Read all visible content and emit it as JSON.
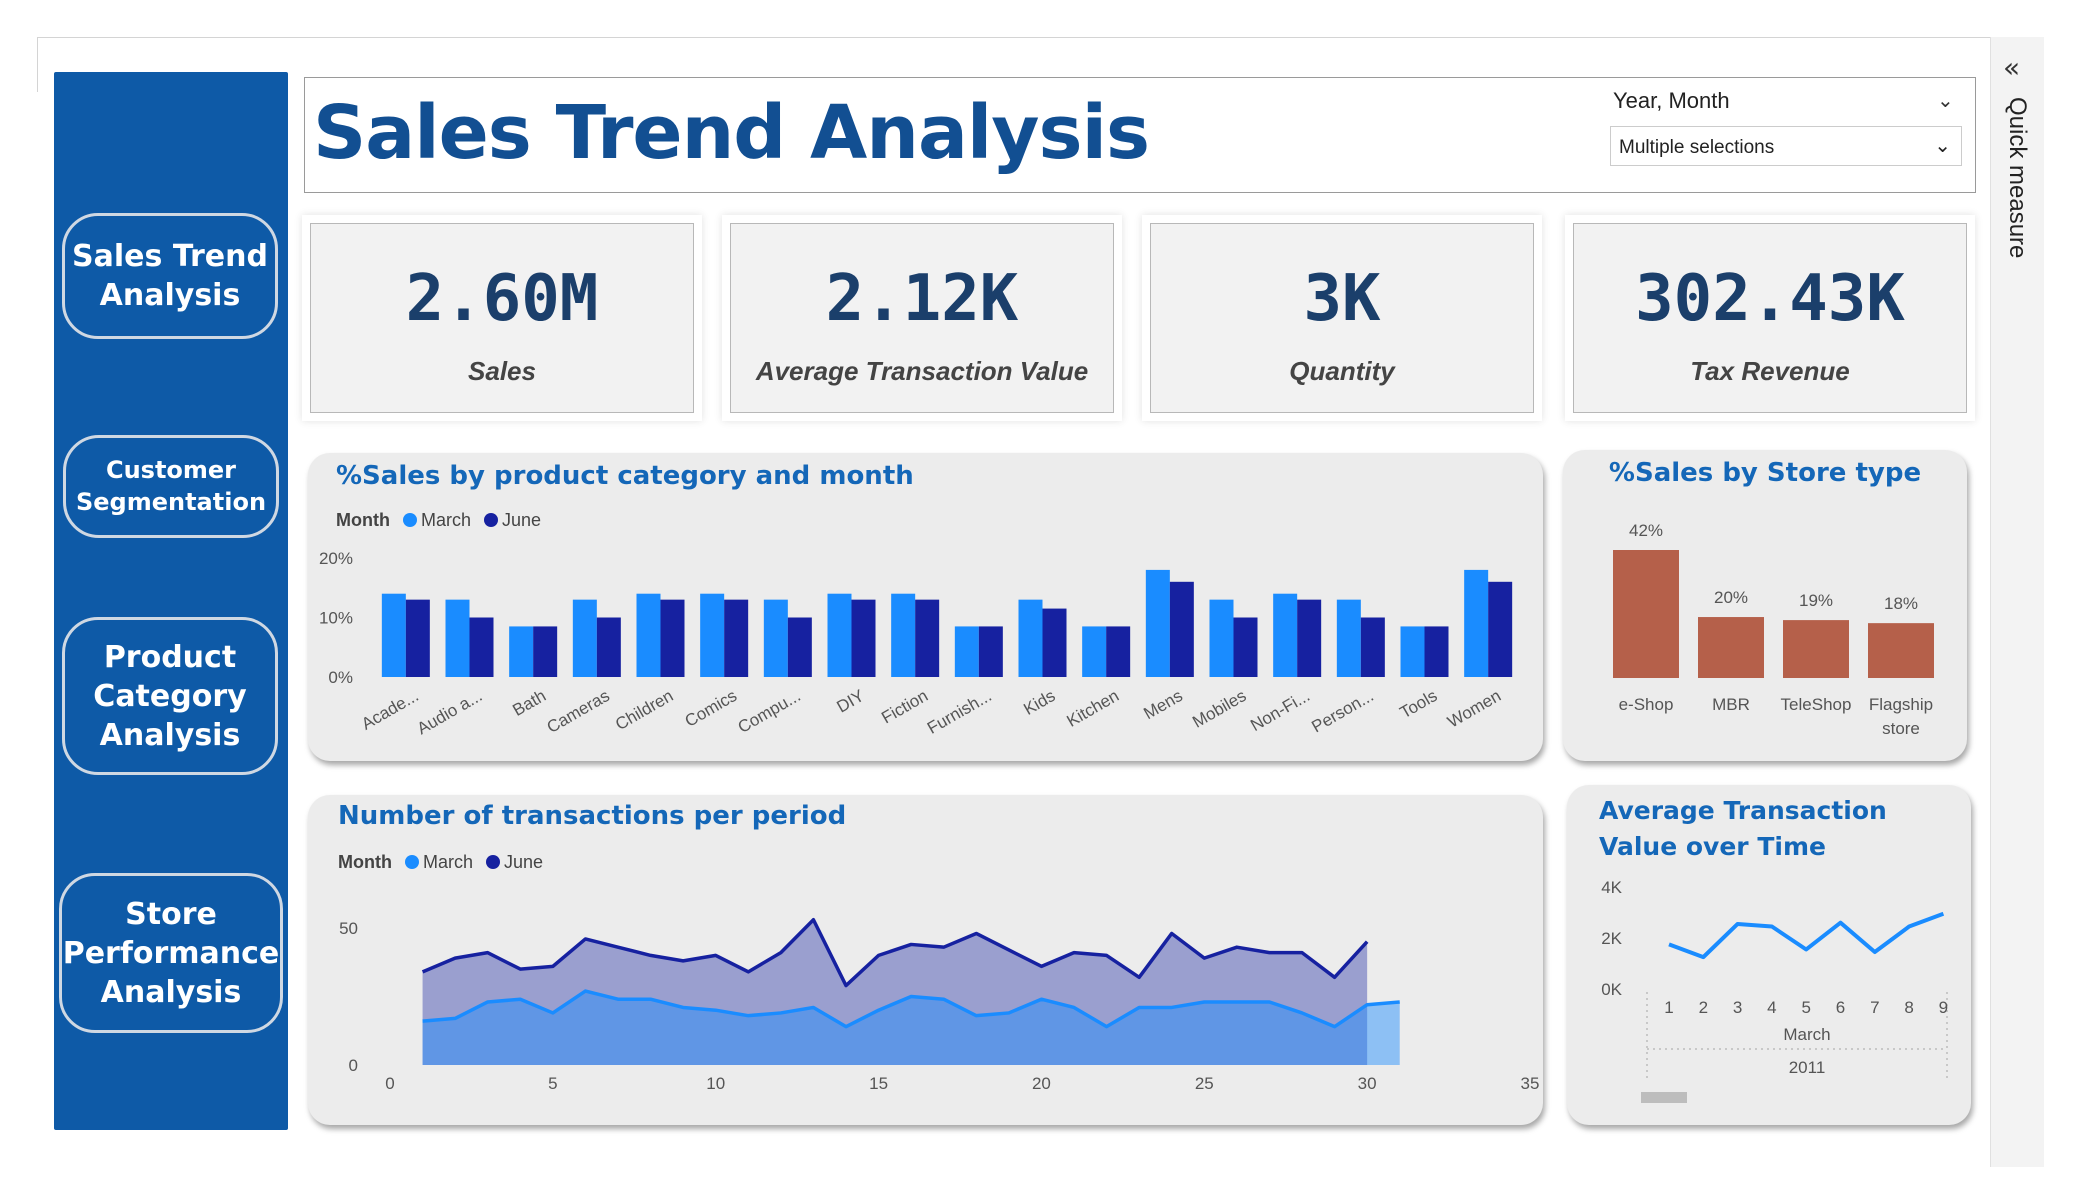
{
  "sidebar": {
    "items": [
      {
        "lines": [
          "Sales Trend",
          "Analysis"
        ]
      },
      {
        "lines": [
          "Customer",
          "Segmentation"
        ]
      },
      {
        "lines": [
          "Product",
          "Category",
          "Analysis"
        ]
      },
      {
        "lines": [
          "Store",
          "Performance",
          "Analysis"
        ]
      }
    ]
  },
  "header": {
    "title": "Sales Trend Analysis",
    "slicer": {
      "label": "Year, Month",
      "value": "Multiple selections"
    }
  },
  "quick_pane": {
    "label": "Quick measure"
  },
  "kpis": [
    {
      "value": "2.60M",
      "label": "Sales"
    },
    {
      "value": "2.12K",
      "label": "Average Transaction Value"
    },
    {
      "value": "3K",
      "label": "Quantity"
    },
    {
      "value": "302.43K",
      "label": "Tax Revenue"
    }
  ],
  "colors": {
    "march": "#1a8cff",
    "june": "#1621a0",
    "store": "#b5604a",
    "accent": "#1467b8",
    "sidebar": "#0e5aa7"
  },
  "chart_data": [
    {
      "type": "bar",
      "title": "%Sales by product category and month",
      "legend_title": "Month",
      "categories": [
        "Acade...",
        "Audio a...",
        "Bath",
        "Cameras",
        "Children",
        "Comics",
        "Compu...",
        "DIY",
        "Fiction",
        "Furnish...",
        "Kids",
        "Kitchen",
        "Mens",
        "Mobiles",
        "Non-Fi...",
        "Person...",
        "Tools",
        "Women"
      ],
      "series": [
        {
          "name": "March",
          "values": [
            14,
            13,
            8.5,
            13,
            14,
            14,
            13,
            14,
            14,
            8.5,
            13,
            8.5,
            18,
            13,
            14,
            13,
            8.5,
            18
          ]
        },
        {
          "name": "June",
          "values": [
            13,
            10,
            8.5,
            10,
            13,
            13,
            10,
            13,
            13,
            8.5,
            11.5,
            8.5,
            16,
            10,
            13,
            10,
            8.5,
            16
          ]
        }
      ],
      "yticks": [
        "0%",
        "10%",
        "20%"
      ],
      "ylim": [
        0,
        20
      ]
    },
    {
      "type": "bar",
      "title": "%Sales by Store type",
      "categories": [
        "e-Shop",
        "MBR",
        "TeleShop",
        "Flagship store"
      ],
      "values": [
        42,
        20,
        19,
        18
      ],
      "data_labels": [
        "42%",
        "20%",
        "19%",
        "18%"
      ]
    },
    {
      "type": "area",
      "title": "Number of transactions per period",
      "legend_title": "Month",
      "xticks": [
        "0",
        "5",
        "10",
        "15",
        "20",
        "25",
        "30",
        "35"
      ],
      "yticks": [
        "0",
        "50"
      ],
      "xlim": [
        0,
        35
      ],
      "ylim": [
        0,
        50
      ],
      "series": [
        {
          "name": "March",
          "x": [
            1,
            2,
            3,
            4,
            5,
            6,
            7,
            8,
            9,
            10,
            11,
            12,
            13,
            14,
            15,
            16,
            17,
            18,
            19,
            20,
            21,
            22,
            23,
            24,
            25,
            26,
            27,
            28,
            29,
            30,
            31
          ],
          "values": [
            16,
            17,
            23,
            24,
            19,
            27,
            24,
            24,
            21,
            20,
            18,
            19,
            21,
            14,
            20,
            25,
            24,
            18,
            19,
            24,
            21,
            14,
            21,
            21,
            23,
            23,
            23,
            19,
            14,
            22,
            23
          ]
        },
        {
          "name": "June",
          "x": [
            1,
            2,
            3,
            4,
            5,
            6,
            7,
            8,
            9,
            10,
            11,
            12,
            13,
            14,
            15,
            16,
            17,
            18,
            19,
            20,
            21,
            22,
            23,
            24,
            25,
            26,
            27,
            28,
            29,
            30
          ],
          "values": [
            34,
            39,
            41,
            35,
            36,
            46,
            43,
            40,
            38,
            40,
            34,
            41,
            53,
            29,
            40,
            44,
            43,
            48,
            42,
            36,
            41,
            40,
            32,
            48,
            39,
            43,
            41,
            41,
            32,
            45
          ]
        }
      ]
    },
    {
      "type": "line",
      "title": "Average Transaction Value over Time",
      "x": [
        "1",
        "2",
        "3",
        "4",
        "5",
        "6",
        "7",
        "8",
        "9"
      ],
      "values": [
        1.75,
        1.25,
        2.55,
        2.45,
        1.55,
        2.6,
        1.45,
        2.45,
        2.95
      ],
      "yticks": [
        "0K",
        "2K",
        "4K"
      ],
      "ylim": [
        0,
        4
      ],
      "x_group_label": "March",
      "x_group_label_2": "2011"
    }
  ]
}
